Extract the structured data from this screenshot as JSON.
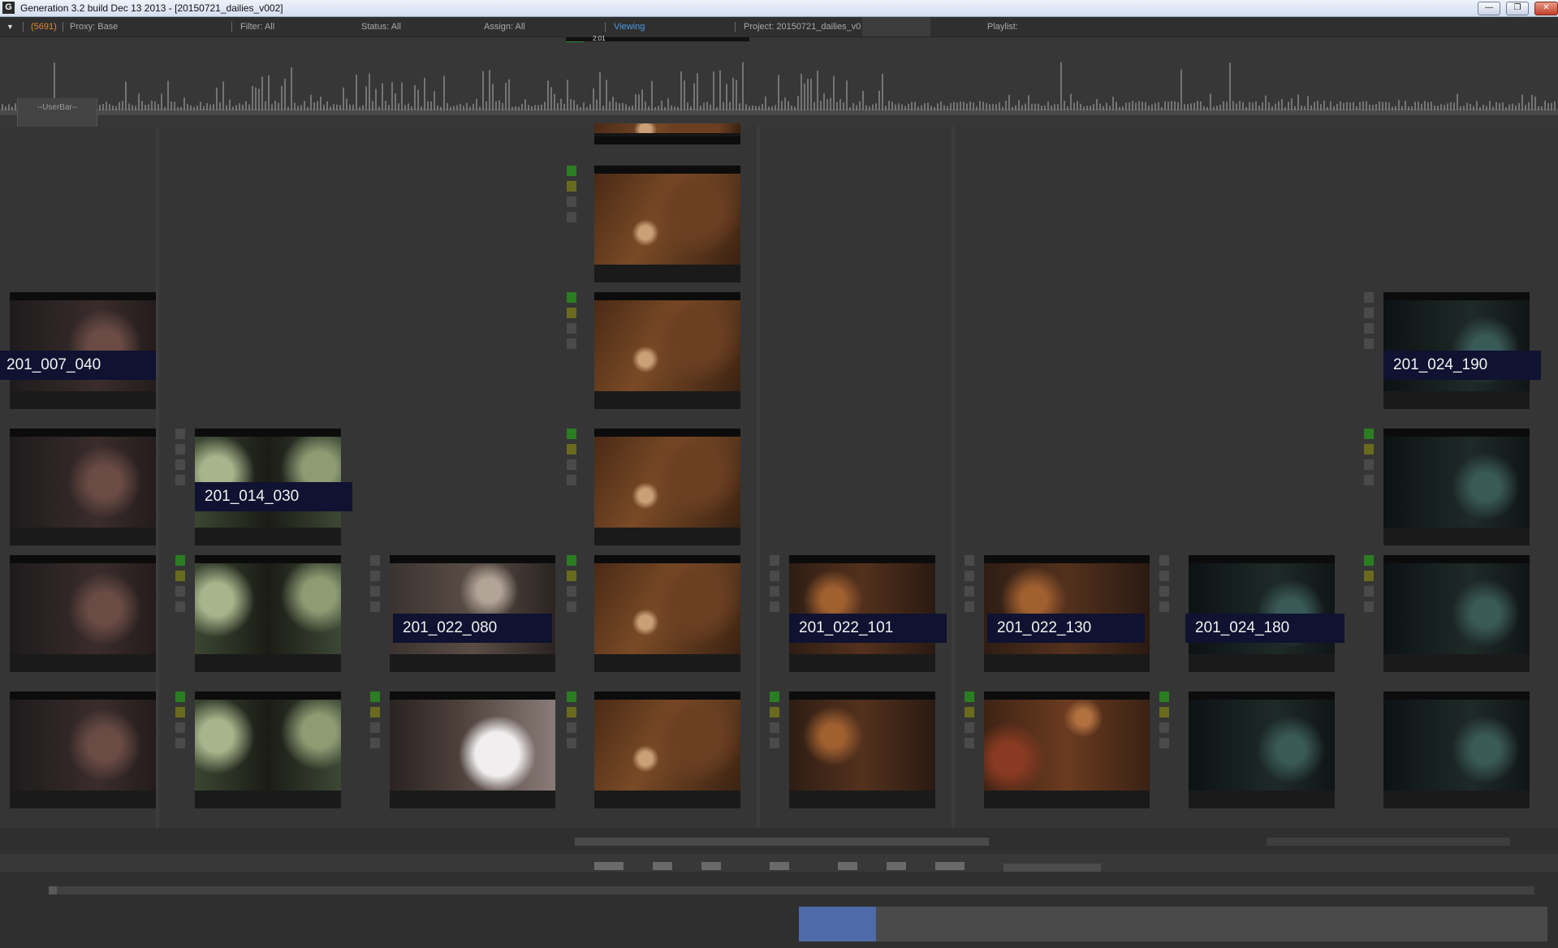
{
  "window": {
    "title": "Generation 3.2 build Dec 13 2013 - [20150721_dailies_v002]",
    "app_icon": "G",
    "minimize_icon": "minimize-icon",
    "maximize_icon": "restore-icon",
    "close_icon": "close-icon"
  },
  "toolbar": {
    "dropdown_glyph": "▼",
    "count": "(5691)",
    "proxy": "Proxy: Base",
    "filter": "Filter: All",
    "status": "Status: All",
    "assign": "Assign: All",
    "viewing": "Viewing",
    "project": "Project: 20150721_dailies_v0",
    "playlist": "Playlist:",
    "accent_color": "#4a9ae8",
    "count_color": "#e0882e"
  },
  "histogram": {
    "userbar_label": "--UserBar--",
    "timecode": "2:01"
  },
  "shot_labels": {
    "s1": "201_007_040",
    "s2": "201_014_030",
    "s3": "201_022_080",
    "s4": "201_022_101",
    "s5": "201_022_130",
    "s6": "201_024_180",
    "s7": "201_024_190"
  },
  "colors": {
    "status_green": "#2b7d22",
    "status_olive": "#6a6a1f",
    "label_bg": "#0f1230",
    "scrub_highlight": "#4e6aa8"
  }
}
